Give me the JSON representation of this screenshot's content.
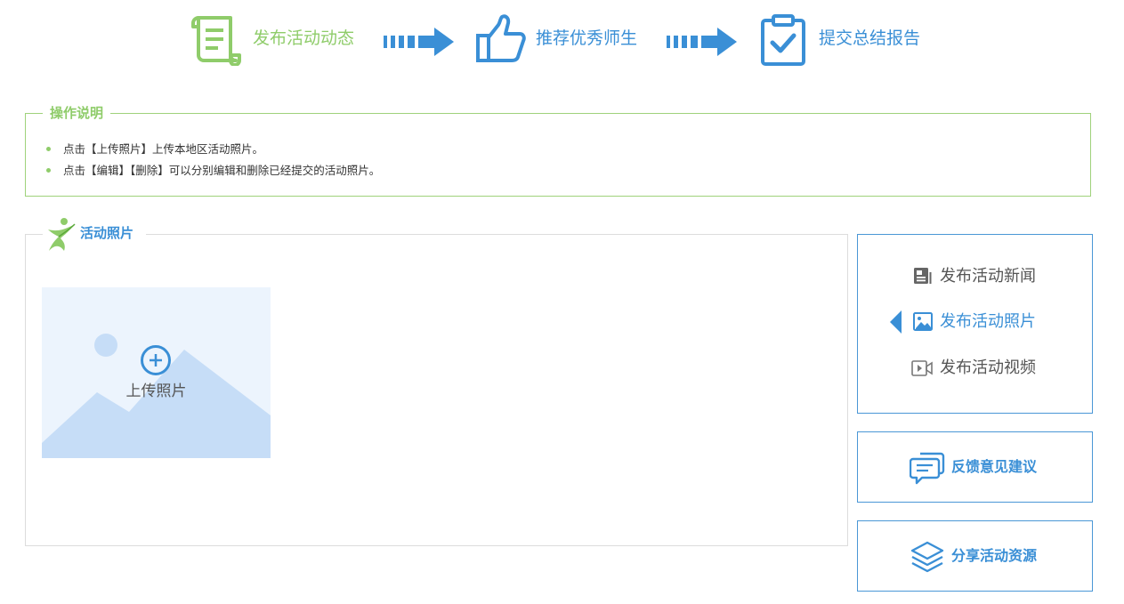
{
  "steps": [
    {
      "label": "发布活动动态",
      "icon": "scroll-icon",
      "state": "active"
    },
    {
      "label": "推荐优秀师生",
      "icon": "thumbs-up-icon",
      "state": "normal"
    },
    {
      "label": "提交总结报告",
      "icon": "clipboard-check-icon",
      "state": "normal"
    }
  ],
  "instructions": {
    "title": "操作说明",
    "lines": [
      "点击【上传照片】上传本地区活动照片。",
      "点击【编辑】【删除】可以分别编辑和删除已经提交的活动照片。"
    ]
  },
  "photos": {
    "title": "活动照片",
    "upload_label": "上传照片"
  },
  "side_menu": {
    "items": [
      {
        "label": "发布活动新闻",
        "icon": "news-icon",
        "active": false
      },
      {
        "label": "发布活动照片",
        "icon": "image-icon",
        "active": true
      },
      {
        "label": "发布活动视频",
        "icon": "video-icon",
        "active": false
      }
    ]
  },
  "side_buttons": {
    "feedback": "反馈意见建议",
    "share": "分享活动资源"
  },
  "colors": {
    "green_accent": "#8fcc6a",
    "blue_accent": "#3a8fd6",
    "panel_border": "#4a97d6"
  }
}
